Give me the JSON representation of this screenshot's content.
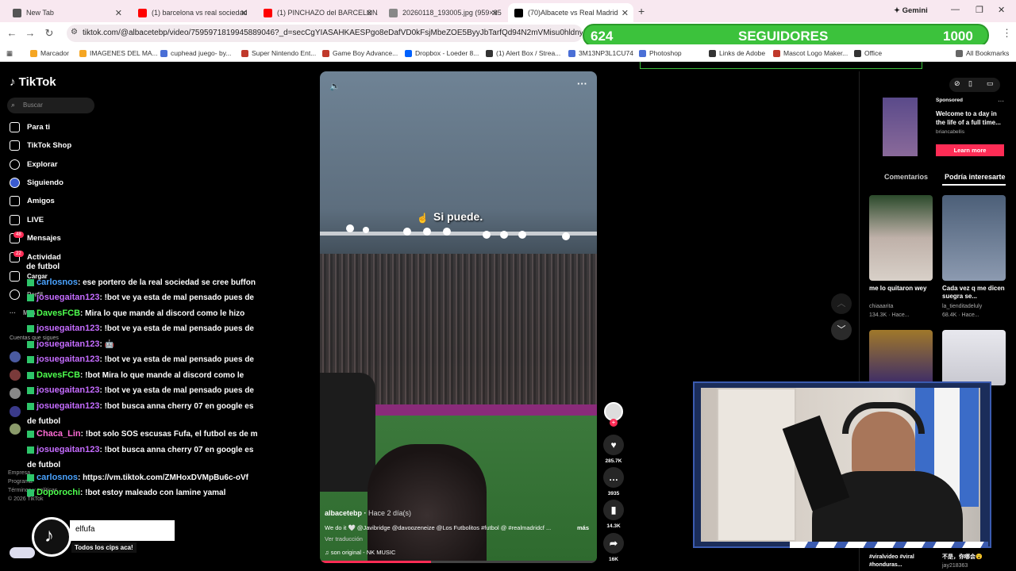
{
  "browser": {
    "tabs": [
      {
        "title": "New Tab",
        "color": "#555555"
      },
      {
        "title": "(1) barcelona vs real sociedad",
        "color": "#ff0000"
      },
      {
        "title": "(1) PINCHAZO del BARCELONA",
        "color": "#ff0000"
      },
      {
        "title": "20260118_193005.jpg (959×95",
        "color": "#888888"
      },
      {
        "title": "(70)Albacete vs Real Madrid",
        "color": "#000000"
      }
    ],
    "gemini_label": "Gemini",
    "url": "tiktok.com/@albacetebp/video/7595971819945889046?_d=secCgYIASAHKAESPgo8eDafVD0kFsjMbeZOE5ByyJbTarfQd94N2mVMisu0hldnykQFMahKGR",
    "bookmarks": [
      "Marcador",
      "IMAGENES DEL MA...",
      "cuphead juego- by...",
      "Super Nintendo Ent...",
      "Game Boy Advance...",
      "Dropbox - Loeder 8...",
      "(1) Alert Box / Strea...",
      "3M13NP3L1CU74",
      "Photoshop",
      "Links de Adobe",
      "Mascot Logo Maker...",
      "Office"
    ],
    "all_bookmarks": "All Bookmarks"
  },
  "overlay": {
    "followers_current": "624",
    "followers_label": "SEGUIDORES",
    "followers_goal": "1000"
  },
  "tiktok": {
    "logo": "TikTok",
    "search_placeholder": "Buscar",
    "nav": [
      "Para ti",
      "TikTok Shop",
      "Explorar",
      "Siguiendo",
      "Amigos",
      "LIVE",
      "Mensajes",
      "Actividad",
      "Cargar",
      "Perfil",
      "Más"
    ],
    "messages_badge": "48",
    "activity_badge": "22",
    "following_label": "Cuentas que sigues",
    "footer": [
      "Empresa",
      "Programa",
      "Términos y políticas",
      "© 2026 TikTok"
    ],
    "caption_text": "Si puede.",
    "author": "albacetebp",
    "time_ago": "Hace 2 día(s)",
    "description": "We do it 🤍 @Javibridge @davoozeneize @Los Futbolitos #futbol @ #realmadridcf ...",
    "more": "más",
    "translation": "Ver traducción",
    "sound": "son original - NK MUSIC",
    "likes": "285.7K",
    "comments": "3935",
    "saves": "14.3K",
    "shares": "16K",
    "sponsored": {
      "label": "Sponsored",
      "text": "Welcome to a day in the life of a full time...",
      "user": "briancabellis",
      "cta": "Learn more"
    },
    "right_tabs": [
      "Comentarios",
      "Podría interesarte"
    ],
    "cards": [
      {
        "title": "me lo quitaron wey",
        "user": "chiaaarita",
        "stats": "134.3K · Hace..."
      },
      {
        "title": "Cada vez q me dicen suegra se...",
        "user": "la_tienditadeluly",
        "stats": "68.4K · Hace..."
      },
      {
        "title": "#viralvideo #viral #honduras...",
        "user": "",
        "stats": ""
      },
      {
        "title": "不是，你哪会😮",
        "user": "jay218363",
        "stats": ""
      }
    ]
  },
  "chat": [
    {
      "user": "carlosnos",
      "msg": ": ese portero de la real sociedad se cree buffon",
      "color": "#4aa3ff"
    },
    {
      "user": "josuegaitan123",
      "msg": ": !bot ve ya esta de mal pensado pues de",
      "color": "#c56cff"
    },
    {
      "user": "DavesFCB",
      "msg": ": Mira lo que mande al discord como le hizo",
      "color": "#4eff4e"
    },
    {
      "user": "josuegaitan123",
      "msg": ": !bot ve ya esta de mal pensado pues de",
      "color": "#c56cff"
    },
    {
      "user": "josuegaitan123",
      "msg": ": 🤖",
      "color": "#c56cff"
    },
    {
      "user": "josuegaitan123",
      "msg": ": !bot ve ya esta de mal pensado pues de",
      "color": "#c56cff"
    },
    {
      "user": "DavesFCB",
      "msg": ": !bot Mira lo que mande al discord como le",
      "color": "#4eff4e"
    },
    {
      "user": "josuegaitan123",
      "msg": ": !bot ve ya esta de mal pensado pues de",
      "color": "#c56cff"
    },
    {
      "user": "josuegaitan123",
      "msg": ": !bot busca anna cherry 07 en google es",
      "color": "#c56cff"
    },
    {
      "user": "Chaca_Lin",
      "msg": ": !bot solo SOS escusas Fufa, el futbol es de m",
      "color": "#ff6bd6"
    },
    {
      "user": "josuegaitan123",
      "msg": ": !bot busca anna cherry 07 en google es",
      "color": "#c56cff"
    },
    {
      "user": "carlosnos",
      "msg": ": https://vm.tiktok.com/ZMHoxDVMpBu6c-oVf",
      "color": "#4aa3ff"
    },
    {
      "user": "Doporochi",
      "msg": ": !bot estoy maleado con lamine yamal",
      "color": "#4eff4e"
    }
  ],
  "chat_wrap": "de futbol",
  "alert": {
    "name": "elfufa",
    "text": "Todos los cips aca!"
  }
}
